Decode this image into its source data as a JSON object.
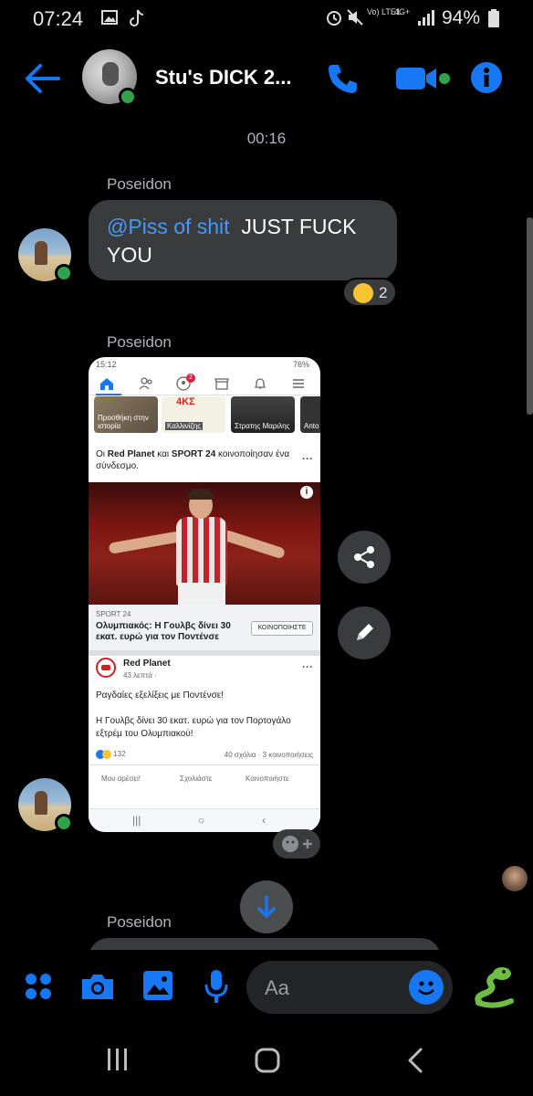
{
  "status_bar": {
    "time": "07:24",
    "network": "Vo) LTE1",
    "network_gen": "4G+",
    "battery": "94%"
  },
  "header": {
    "title": "Stu's DICK 2...",
    "accent_color": "#1877f2"
  },
  "conversation": {
    "timestamp": "00:16",
    "messages": [
      {
        "sender": "Poseidon",
        "mention": "@Piss of shit",
        "text": "JUST FUCK YOU",
        "reaction_count": "2"
      },
      {
        "sender": "Poseidon",
        "type": "image",
        "image": {
          "status_time": "15:12",
          "status_battery": "76%",
          "badge_count": "2",
          "stories": [
            "Προσθήκη στην ιστορία",
            "Καλλινίζης",
            "Στρατης Μαριλης",
            "Anto Soul"
          ],
          "story_logo": "4ΚΣ",
          "shared_line_pre": "Οι ",
          "shared_name_1": "Red Planet",
          "shared_mid": " και ",
          "shared_name_2": "SPORT 24",
          "shared_line_post": " κοινοποίησαν ένα σύνδεσμο.",
          "link_source": "SPORT 24",
          "link_title": "Ολυμπιακός: Η Γουλβς δίνει 30 εκατ. ευρώ για τον Ποντένσε",
          "share_button": "ΚΟΙΝΟΠΟΙΗΣΤΕ",
          "page_name": "Red Planet",
          "post_time": "43 λεπτά ·",
          "post_text_1": "Ραγδαίες εξελίξεις με Ποντένσε!",
          "post_text_2": "Η Γουλβς δίνει 30 εκατ. ευρώ για τον Πορτογάλο εξτρέμ του Ολυμπιακού!",
          "reactions": "132",
          "comments_shares": "40 σχόλια · 3 κοινοποιήσεις",
          "action_like": "Μου αρέσει!",
          "action_comment": "Σχολιάστε",
          "action_share": "Κοινοποιήστε"
        }
      },
      {
        "sender": "Poseidon"
      }
    ]
  },
  "composer": {
    "placeholder": "Aa"
  },
  "colors": {
    "online": "#31a24c",
    "bubble": "#3a3b3c",
    "mention": "#4599ff"
  }
}
